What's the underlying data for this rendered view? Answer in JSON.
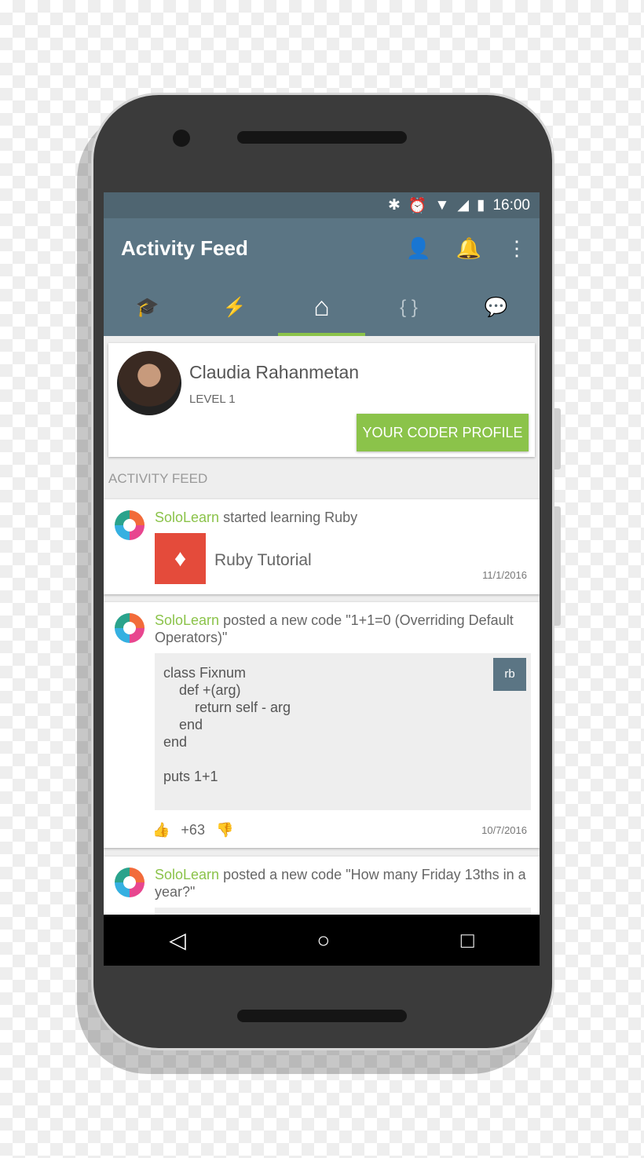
{
  "status_bar": {
    "time": "16:00",
    "icons": [
      "bluetooth-icon",
      "alarm-icon",
      "wifi-icon",
      "signal-icon",
      "battery-icon"
    ]
  },
  "app_bar": {
    "title": "Activity Feed",
    "actions": [
      "profile-icon",
      "bell-icon",
      "more-vert-icon"
    ]
  },
  "tabs": [
    {
      "icon": "graduation-cap-icon",
      "glyph": "🎓"
    },
    {
      "icon": "lightning-icon",
      "glyph": "⚡"
    },
    {
      "icon": "home-icon",
      "glyph": "⌂",
      "active": true
    },
    {
      "icon": "code-braces-icon",
      "glyph": "{ }"
    },
    {
      "icon": "chat-icon",
      "glyph": "💬"
    }
  ],
  "profile": {
    "name": "Claudia Rahanmetan",
    "level": "LEVEL 1",
    "button": "YOUR CODER PROFILE"
  },
  "section_title": "ACTIVITY FEED",
  "feed": [
    {
      "user": "SoloLearn",
      "action": " started learning Ruby",
      "course": "Ruby Tutorial",
      "date": "11/1/2016"
    },
    {
      "user": "SoloLearn",
      "action": " posted a new code \"1+1=0 (Overriding Default Operators)\"",
      "code": "class Fixnum\n    def +(arg)\n        return self - arg\n    end\nend\n\nputs 1+1",
      "lang": "rb",
      "votes": "+63",
      "date": "10/7/2016"
    },
    {
      "user": "SoloLearn",
      "action": " posted a new code \"How many Friday 13ths in a year?\""
    }
  ],
  "colors": {
    "accent": "#8bc34a",
    "appbar": "#5b7584",
    "status": "#4f6571",
    "ruby": "#e44b3b"
  }
}
